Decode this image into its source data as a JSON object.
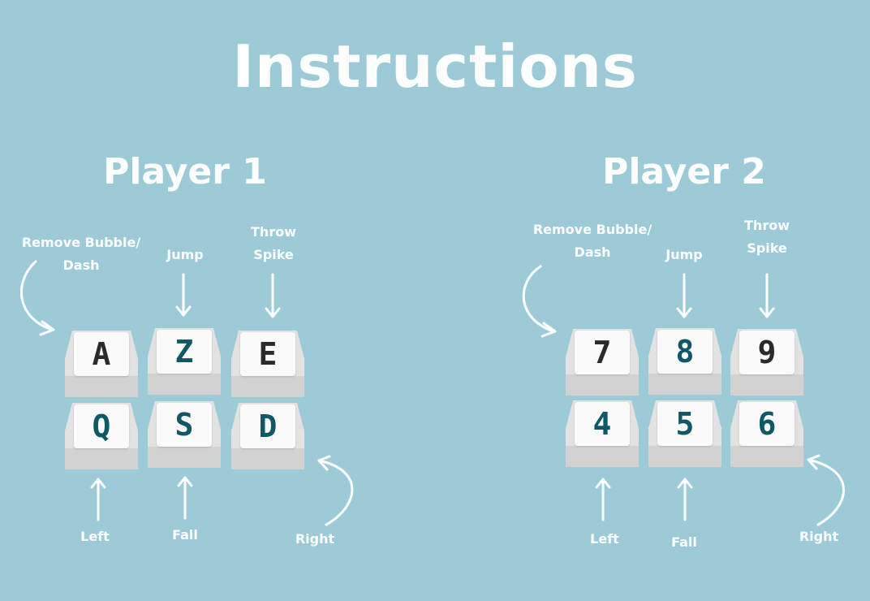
{
  "title": "Instructions",
  "colors": {
    "background": "#9ccbd7",
    "text": "#ffffff",
    "key_dark": "#2b2b2b",
    "key_teal": "#0f5866"
  },
  "players": [
    {
      "name": "Player 1",
      "labels": {
        "remove_bubble_1": "Remove Bubble/",
        "remove_bubble_2": "Dash",
        "jump": "Jump",
        "throw_1": "Throw",
        "throw_2": "Spike",
        "left": "Left",
        "fall": "Fall",
        "right": "Right"
      },
      "keys": {
        "top_left": "A",
        "top_mid": "Z",
        "top_right": "E",
        "bot_left": "Q",
        "bot_mid": "S",
        "bot_right": "D"
      }
    },
    {
      "name": "Player 2",
      "labels": {
        "remove_bubble_1": "Remove Bubble/",
        "remove_bubble_2": "Dash",
        "jump": "Jump",
        "throw_1": "Throw",
        "throw_2": "Spike",
        "left": "Left",
        "fall": "Fall",
        "right": "Right"
      },
      "keys": {
        "top_left": "7",
        "top_mid": "8",
        "top_right": "9",
        "bot_left": "4",
        "bot_mid": "5",
        "bot_right": "6"
      }
    }
  ]
}
